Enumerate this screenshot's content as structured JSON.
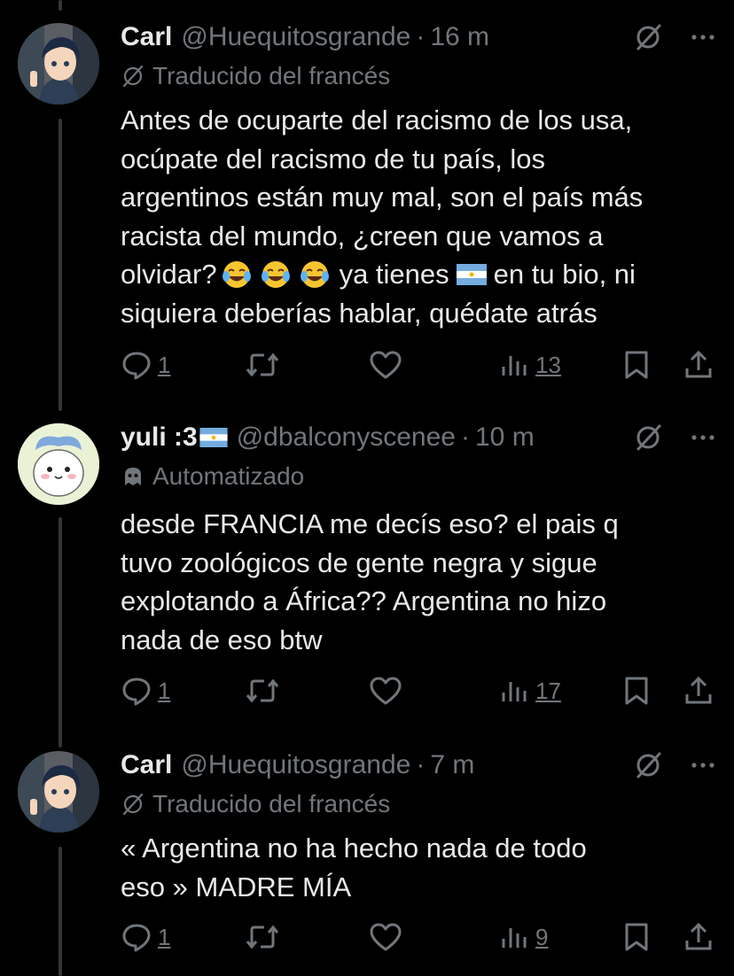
{
  "tweets": [
    {
      "name": "Carl",
      "handle": "@Huequitosgrande",
      "dot": "·",
      "time": "16 m",
      "subline": "Traducido del francés",
      "lines": [
        "Antes de ocuparte del racismo de los usa,",
        "ocúpate del racismo de tu país, los",
        "argentinos están muy mal, son el país más",
        "racista del mundo, ¿creen que vamos a"
      ],
      "line5_pre": "olvidar?",
      "emoji_name": "face-with-tears-of-joy-emoji",
      "line5_mid": "ya tienes",
      "line5_post": "en tu bio, ni",
      "line6": "siquiera deberías hablar, quédate atrás",
      "replies": "1",
      "views": "13"
    },
    {
      "name": "yuli :3",
      "handle": "@dbalconyscenee",
      "dot": "·",
      "time": "10 m",
      "subline": "Automatizado",
      "lines": [
        "desde FRANCIA me decís eso? el pais q",
        "tuvo zoológicos de gente negra y sigue",
        "explotando a África?? Argentina no hizo",
        "nada de eso btw"
      ],
      "replies": "1",
      "views": "17"
    },
    {
      "name": "Carl",
      "handle": "@Huequitosgrande",
      "dot": "·",
      "time": "7 m",
      "subline": "Traducido del francés",
      "lines": [
        "« Argentina no ha hecho nada de todo",
        "eso » MADRE MÍA"
      ],
      "replies": "1",
      "views": "9"
    }
  ],
  "icons": [
    "reply-icon",
    "retweet-icon",
    "like-icon",
    "views-icon",
    "bookmark-icon",
    "share-icon",
    "grok-icon",
    "more-icon",
    "translate-icon",
    "bot-icon"
  ],
  "colors": {
    "background": "#000000",
    "text": "#e7e9ea",
    "muted": "#71767b",
    "thread_line": "#333639",
    "flag_blue": "#74acdf"
  }
}
